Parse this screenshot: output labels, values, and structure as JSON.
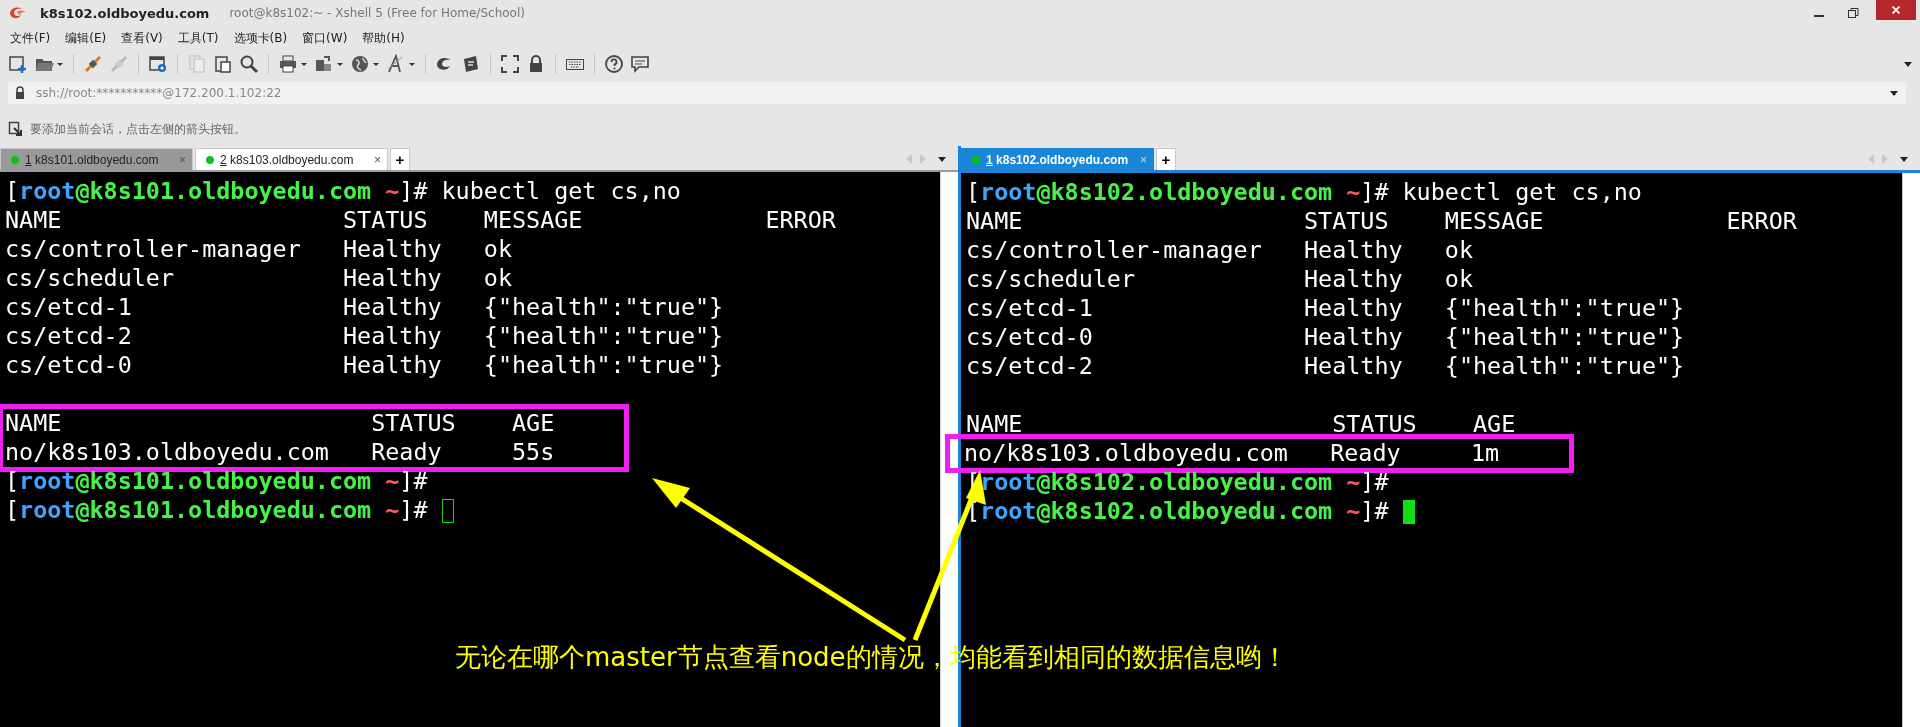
{
  "window": {
    "title": "k8s102.oldboyedu.com",
    "subtitle": "root@k8s102:~ - Xshell 5 (Free for Home/School)"
  },
  "menu": [
    "文件(F)",
    "编辑(E)",
    "查看(V)",
    "工具(T)",
    "选项卡(B)",
    "窗口(W)",
    "帮助(H)"
  ],
  "address": {
    "value": "ssh://root:***********@172.200.1.102:22"
  },
  "hint": "要添加当前会话，点击左侧的箭头按钮。",
  "panes": [
    {
      "focused": false,
      "add_tab": "+",
      "tabs": [
        {
          "number": "1",
          "label": "k8s101.oldboyedu.com",
          "selected": false,
          "connected": true,
          "close": "×"
        },
        {
          "number": "2",
          "label": "k8s103.oldboyedu.com",
          "selected": true,
          "connected": true,
          "close": "×"
        }
      ],
      "blocks": [
        {
          "highlighted": false,
          "lines": [
            {
              "kind": "prompt",
              "open": "[",
              "user": "root",
              "host": "@k8s101.oldboyedu.com",
              "dir": " ~",
              "close": "]#",
              "command": "kubectl get cs,no",
              "cursor": false
            },
            {
              "kind": "output",
              "text": "NAME                    STATUS    MESSAGE             ERROR"
            },
            {
              "kind": "output",
              "text": "cs/controller-manager   Healthy   ok"
            },
            {
              "kind": "output",
              "text": "cs/scheduler            Healthy   ok"
            },
            {
              "kind": "output",
              "text": "cs/etcd-1               Healthy   {\"health\":\"true\"}"
            },
            {
              "kind": "output",
              "text": "cs/etcd-2               Healthy   {\"health\":\"true\"}"
            },
            {
              "kind": "output",
              "text": "cs/etcd-0               Healthy   {\"health\":\"true\"}"
            },
            {
              "kind": "blank"
            }
          ]
        },
        {
          "highlighted": true,
          "lines": [
            {
              "kind": "output",
              "text": "NAME                      STATUS    AGE"
            },
            {
              "kind": "output",
              "text": "no/k8s103.oldboyedu.com   Ready     55s"
            }
          ]
        },
        {
          "highlighted": false,
          "lines": [
            {
              "kind": "prompt",
              "open": "[",
              "user": "root",
              "host": "@k8s101.oldboyedu.com",
              "dir": " ~",
              "close": "]#",
              "cursor": false
            },
            {
              "kind": "prompt",
              "open": "[",
              "user": "root",
              "host": "@k8s101.oldboyedu.com",
              "dir": " ~",
              "close": "]#",
              "cursor": true
            }
          ]
        }
      ]
    },
    {
      "focused": true,
      "add_tab": "+",
      "tabs": [
        {
          "number": "1",
          "label": "k8s102.oldboyedu.com",
          "selected": true,
          "connected": true,
          "close": "×"
        }
      ],
      "blocks": [
        {
          "highlighted": false,
          "lines": [
            {
              "kind": "prompt",
              "open": "[",
              "user": "root",
              "host": "@k8s102.oldboyedu.com",
              "dir": " ~",
              "close": "]#",
              "command": "kubectl get cs,no",
              "cursor": false
            },
            {
              "kind": "output",
              "text": "NAME                    STATUS    MESSAGE             ERROR"
            },
            {
              "kind": "output",
              "text": "cs/controller-manager   Healthy   ok"
            },
            {
              "kind": "output",
              "text": "cs/scheduler            Healthy   ok"
            },
            {
              "kind": "output",
              "text": "cs/etcd-1               Healthy   {\"health\":\"true\"}"
            },
            {
              "kind": "output",
              "text": "cs/etcd-0               Healthy   {\"health\":\"true\"}"
            },
            {
              "kind": "output",
              "text": "cs/etcd-2               Healthy   {\"health\":\"true\"}"
            },
            {
              "kind": "blank"
            },
            {
              "kind": "output",
              "text": "NAME                      STATUS    AGE"
            }
          ]
        },
        {
          "highlighted": true,
          "lines": [
            {
              "kind": "output",
              "text": "no/k8s103.oldboyedu.com   Ready     1m"
            }
          ]
        },
        {
          "highlighted": false,
          "lines": [
            {
              "kind": "prompt",
              "open": "[",
              "user": "root",
              "host": "@k8s102.oldboyedu.com",
              "dir": " ~",
              "close": "]#",
              "cursor": false
            },
            {
              "kind": "prompt",
              "open": "[",
              "user": "root",
              "host": "@k8s102.oldboyedu.com",
              "dir": " ~",
              "close": "]#",
              "cursor": true
            }
          ]
        }
      ]
    }
  ],
  "annotation": {
    "caption": "无论在哪个master节点查看node的情况，均能看到相同的数据信息哟！"
  }
}
